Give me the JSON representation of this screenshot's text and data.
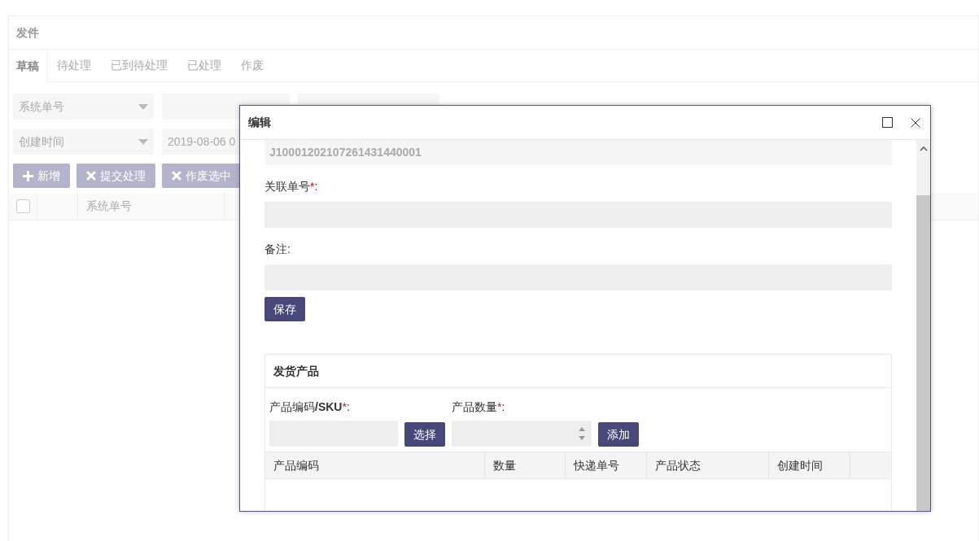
{
  "panel": {
    "title": "发件"
  },
  "tabs": [
    {
      "label": "草稿",
      "selected": true
    },
    {
      "label": "待处理",
      "selected": false
    },
    {
      "label": "已到待处理",
      "selected": false
    },
    {
      "label": "已处理",
      "selected": false
    },
    {
      "label": "作废",
      "selected": false
    }
  ],
  "filters": [
    {
      "field": "系统单号"
    },
    {
      "field": "创建时间",
      "value": "2019-08-06 0"
    }
  ],
  "actions": [
    {
      "kind": "plus",
      "label": "新增"
    },
    {
      "kind": "cross",
      "label": "提交处理"
    },
    {
      "kind": "cross",
      "label": "作废选中"
    }
  ],
  "table": {
    "select_all": {
      "checked": false
    },
    "columns": [
      "系统单号"
    ]
  },
  "dialog": {
    "title": "编辑",
    "order_number": "J10001202107261431440001",
    "fields": [
      {
        "label": "关联单号",
        "required_mark": "*",
        "colon": ":"
      },
      {
        "label": "备注",
        "colon": ":"
      }
    ],
    "save": "保存",
    "products": {
      "title": "发货产品",
      "sku": {
        "label": "产品编码**/SKU**",
        "required_mark": "*",
        "colon": ":",
        "button": "选择"
      },
      "quantity": {
        "label": "产品数量",
        "required_mark": "*",
        "colon": ":",
        "button": "添加"
      },
      "columns": [
        "产品编码",
        "数量",
        "快递单号",
        "产品状态",
        "创建时间"
      ]
    }
  }
}
